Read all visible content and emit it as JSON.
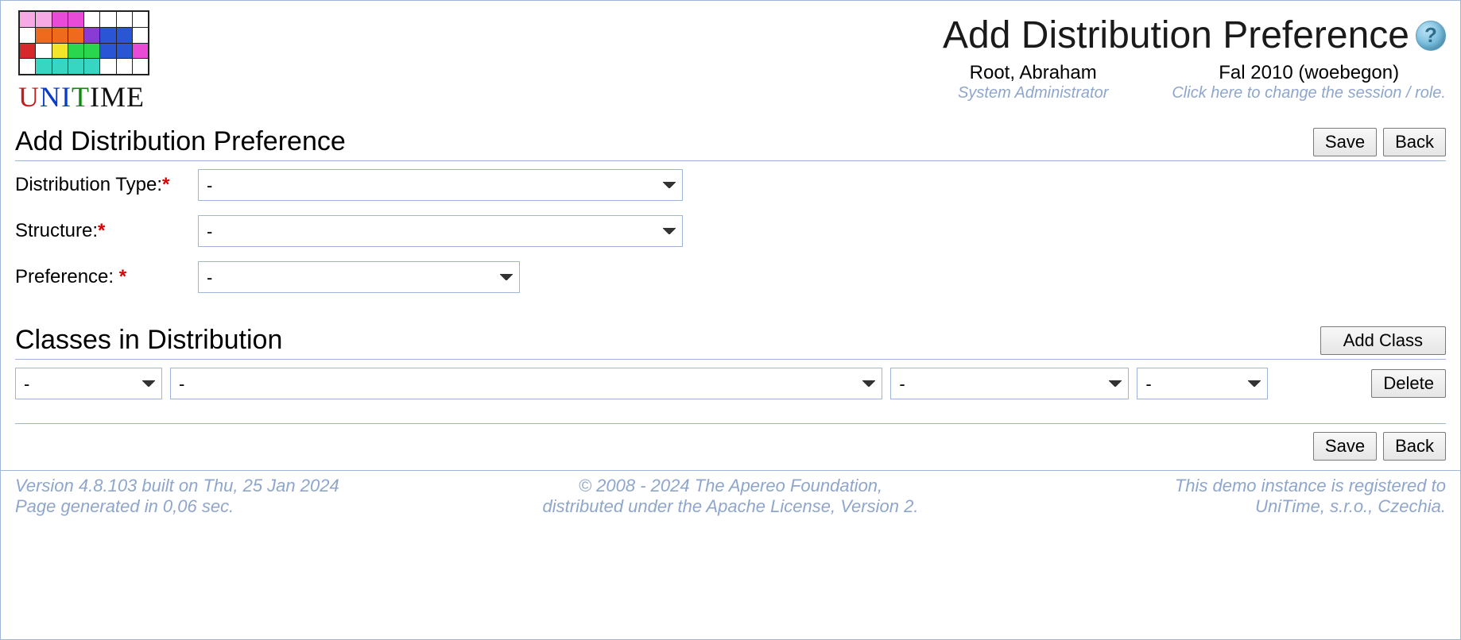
{
  "header": {
    "page_title": "Add Distribution Preference",
    "user_name": "Root, Abraham",
    "user_role": "System Administrator",
    "session_name": "Fal 2010 (woebegon)",
    "session_hint": "Click here to change the session / role."
  },
  "form": {
    "section_title": "Add Distribution Preference",
    "save_label": "Save",
    "back_label": "Back",
    "distribution_type_label": "Distribution Type:",
    "distribution_type_value": "-",
    "structure_label": "Structure:",
    "structure_value": "-",
    "preference_label": "Preference: ",
    "preference_value": "-"
  },
  "classes": {
    "section_title": "Classes in Distribution",
    "add_class_label": "Add Class",
    "delete_label": "Delete",
    "row": {
      "c1": "-",
      "c2": "-",
      "c3": "-",
      "c4": "-"
    }
  },
  "footer": {
    "version_line": "Version 4.8.103 built on Thu, 25 Jan 2024",
    "gen_line": "Page generated in 0,06 sec.",
    "copyright_line1": "© 2008 - 2024 The Apereo Foundation,",
    "copyright_line2": "distributed under the Apache License, Version 2.",
    "reg_line1": "This demo instance is registered to",
    "reg_line2": "UniTime, s.r.o., Czechia."
  },
  "logo_colors": [
    "#f7a9e6",
    "#f7a9e6",
    "#e84bd8",
    "#e84bd8",
    "#ffffff",
    "#ffffff",
    "#ffffff",
    "#ffffff",
    "#ffffff",
    "#f06a1e",
    "#f06a1e",
    "#f06a1e",
    "#8a3bd6",
    "#2a56d6",
    "#2a56d6",
    "#ffffff",
    "#d62a2a",
    "#ffffff",
    "#f2e52a",
    "#2ad64e",
    "#2ad64e",
    "#2a56d6",
    "#2a56d6",
    "#e84bd8",
    "#ffffff",
    "#36d6c2",
    "#36d6c2",
    "#36d6c2",
    "#36d6c2",
    "#ffffff",
    "#ffffff",
    "#ffffff"
  ]
}
